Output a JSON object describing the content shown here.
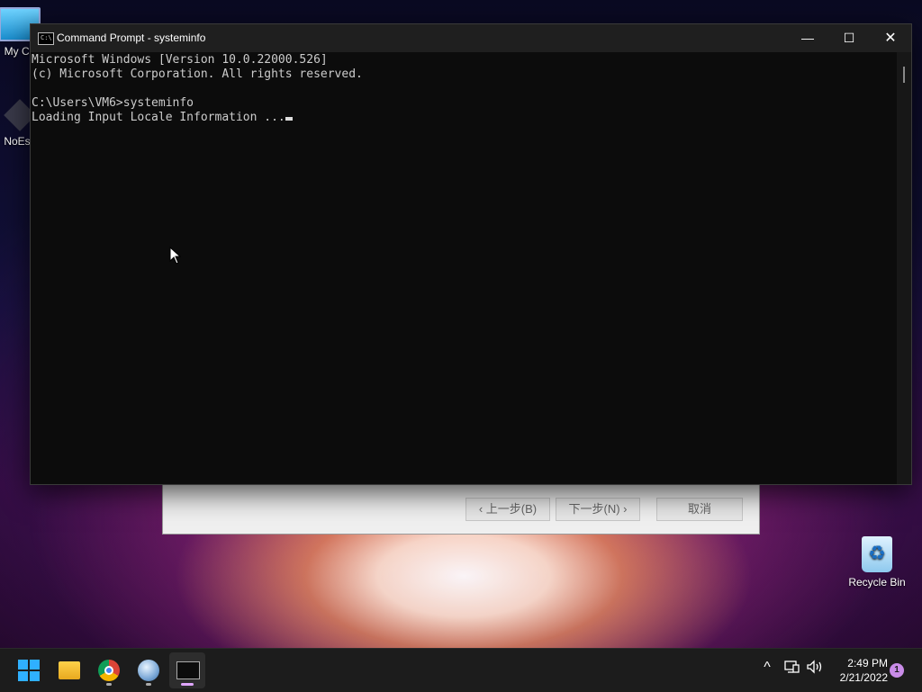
{
  "desktop": {
    "icons": [
      {
        "label": "My Co"
      },
      {
        "label": "NoEsc"
      },
      {
        "label": "Recycle Bin"
      }
    ]
  },
  "background_dialog": {
    "back_label": "‹ 上一步(B)",
    "next_label": "下一步(N) ›",
    "cancel_label": "取消"
  },
  "cmd_window": {
    "title": "Command Prompt - systeminfo",
    "icon_text": "C:\\",
    "controls": {
      "minimize": "—",
      "maximize": "☐",
      "close": "✕"
    },
    "lines": [
      "Microsoft Windows [Version 10.0.22000.526]",
      "(c) Microsoft Corporation. All rights reserved.",
      "",
      "C:\\Users\\VM6>systeminfo",
      "Loading Input Locale Information ..."
    ]
  },
  "taskbar": {
    "apps": [
      {
        "name": "start",
        "icon": "windows-logo-icon"
      },
      {
        "name": "file-explorer",
        "icon": "folder-icon"
      },
      {
        "name": "chrome",
        "icon": "chrome-icon"
      },
      {
        "name": "setup",
        "icon": "setup-globe-icon"
      },
      {
        "name": "command-prompt",
        "icon": "terminal-icon",
        "active": true
      }
    ],
    "tray": {
      "chevron": "^",
      "time": "2:49 PM",
      "date": "2/21/2022",
      "notification_count": "1"
    }
  },
  "colors": {
    "console_bg": "#0c0c0c",
    "console_text": "#cccccc",
    "titlebar_bg": "#1f1f1f",
    "taskbar_bg": "#1c1c1c",
    "accent": "#2fb0ff"
  }
}
